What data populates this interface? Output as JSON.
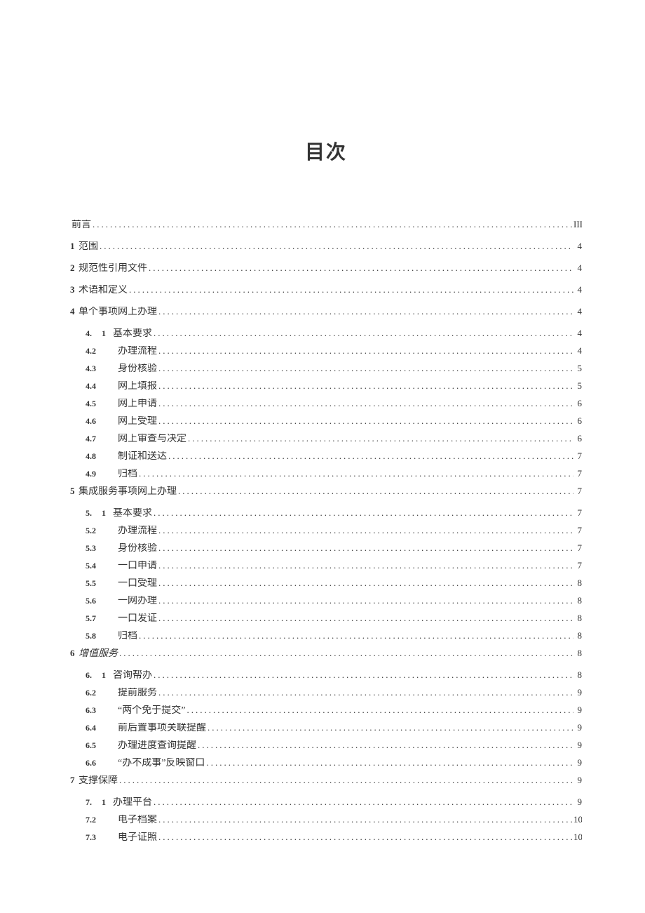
{
  "title": "目次",
  "toc": [
    {
      "level": 0,
      "num": "",
      "text": "前言",
      "page": "III"
    },
    {
      "level": 0,
      "num": "1",
      "text": "范围",
      "page": "4"
    },
    {
      "level": 0,
      "num": "2",
      "text": "规范性引用文件",
      "page": "4"
    },
    {
      "level": 0,
      "num": "3",
      "text": "术语和定义",
      "page": "4"
    },
    {
      "level": 0,
      "num": "4",
      "text": "单个事项网上办理",
      "page": "4"
    },
    {
      "level": 1,
      "numA": "4.",
      "numB": "1",
      "text": "基本要求",
      "page": "4",
      "split": true
    },
    {
      "level": 1,
      "num": "4.2",
      "text": "办理流程",
      "page": "4"
    },
    {
      "level": 1,
      "num": "4.3",
      "text": "身份核验",
      "page": "5"
    },
    {
      "level": 1,
      "num": "4.4",
      "text": "网上填报",
      "page": "5"
    },
    {
      "level": 1,
      "num": "4.5",
      "text": "网上申请",
      "page": "6"
    },
    {
      "level": 1,
      "num": "4.6",
      "text": "网上受理",
      "page": "6"
    },
    {
      "level": 1,
      "num": "4.7",
      "text": "网上审查与决定",
      "page": "6"
    },
    {
      "level": 1,
      "num": "4.8",
      "text": "制证和送达",
      "page": "7"
    },
    {
      "level": 1,
      "num": "4.9",
      "text": "归档",
      "page": "7"
    },
    {
      "level": 0,
      "num": "5",
      "text": "集成服务事项网上办理",
      "page": "7"
    },
    {
      "level": 1,
      "numA": "5.",
      "numB": "1",
      "text": "基本要求",
      "page": "7",
      "split": true
    },
    {
      "level": 1,
      "num": "5.2",
      "text": "办理流程",
      "page": "7"
    },
    {
      "level": 1,
      "num": "5.3",
      "text": "身份核验",
      "page": "7"
    },
    {
      "level": 1,
      "num": "5.4",
      "text": "一口申请",
      "page": "7"
    },
    {
      "level": 1,
      "num": "5.5",
      "text": "一口受理",
      "page": "8"
    },
    {
      "level": 1,
      "num": "5.6",
      "text": "一网办理",
      "page": "8"
    },
    {
      "level": 1,
      "num": "5.7",
      "text": "一口发证",
      "page": "8"
    },
    {
      "level": 1,
      "num": "5.8",
      "text": "归档",
      "page": "8"
    },
    {
      "level": 0,
      "num": "6",
      "text": "增值服务",
      "page": "8",
      "italic": true
    },
    {
      "level": 1,
      "numA": "6.",
      "numB": "1",
      "text": "咨询帮办",
      "page": "8",
      "split": true
    },
    {
      "level": 1,
      "num": "6.2",
      "text": "提前服务",
      "page": "9"
    },
    {
      "level": 1,
      "num": "6.3",
      "text": "“两个免于提交”",
      "page": "9"
    },
    {
      "level": 1,
      "num": "6.4",
      "text": "前后置事项关联提醒",
      "page": "9"
    },
    {
      "level": 1,
      "num": "6.5",
      "text": "办理进度查询提醒",
      "page": "9"
    },
    {
      "level": 1,
      "num": "6.6",
      "text": "“办不成事”反映窗口",
      "page": "9"
    },
    {
      "level": 0,
      "num": "7",
      "text": "支撑保障",
      "page": "9"
    },
    {
      "level": 1,
      "numA": "7.",
      "numB": "1",
      "text": "办理平台",
      "page": "9",
      "split": true
    },
    {
      "level": 1,
      "num": "7.2",
      "text": "电子档案",
      "page": "10"
    },
    {
      "level": 1,
      "num": "7.3",
      "text": "电子证照",
      "page": "10"
    }
  ]
}
